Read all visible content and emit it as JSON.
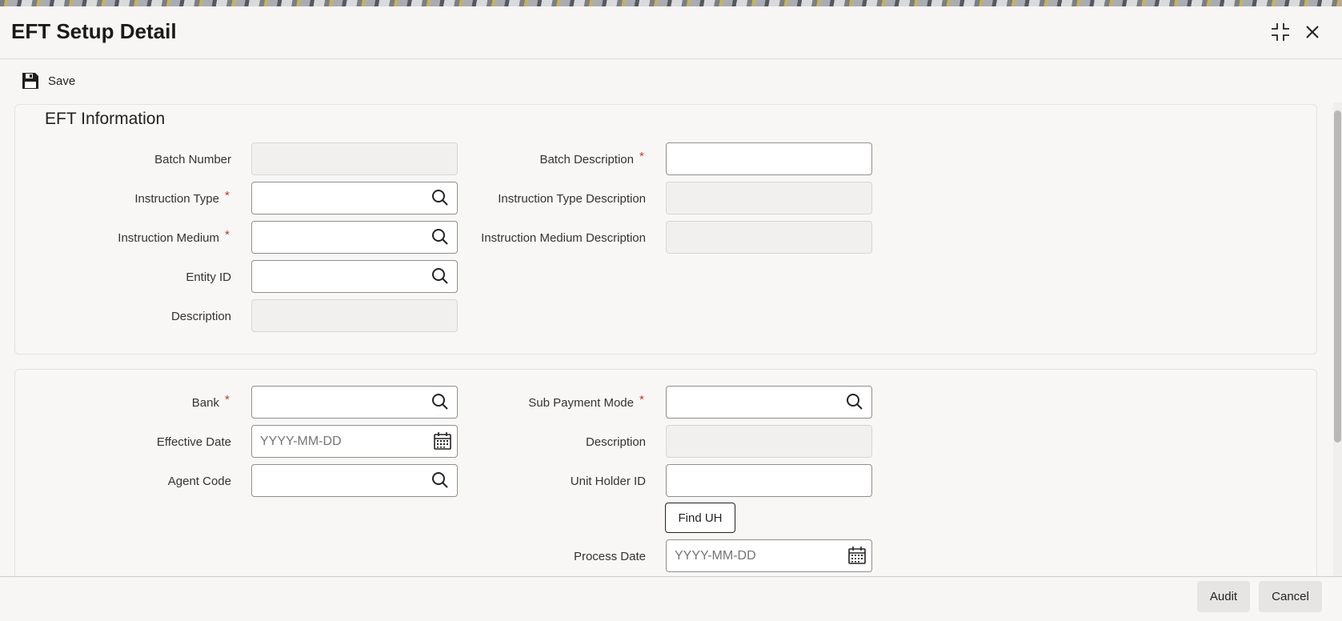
{
  "window": {
    "title": "EFT Setup Detail",
    "restore_icon": "collapse-icon",
    "close_icon": "close-icon"
  },
  "toolbar": {
    "save_label": "Save",
    "save_icon": "floppy-disk-icon"
  },
  "section1": {
    "title": "EFT Information",
    "batch_number_label": "Batch Number",
    "batch_description_label": "Batch Description",
    "instruction_type_label": "Instruction Type",
    "instruction_type_description_label": "Instruction Type Description",
    "instruction_medium_label": "Instruction Medium",
    "instruction_medium_description_label": "Instruction Medium Description",
    "entity_id_label": "Entity ID",
    "description_label": "Description"
  },
  "section2": {
    "bank_label": "Bank",
    "sub_payment_mode_label": "Sub Payment Mode",
    "effective_date_label": "Effective Date",
    "effective_date_placeholder": "YYYY-MM-DD",
    "description_label": "Description",
    "agent_code_label": "Agent Code",
    "unit_holder_id_label": "Unit Holder ID",
    "find_uh_label": "Find UH",
    "process_date_label": "Process Date",
    "process_date_placeholder": "YYYY-MM-DD"
  },
  "required_marker": "*",
  "footer": {
    "audit_label": "Audit",
    "cancel_label": "Cancel"
  },
  "colors": {
    "required": "#c0392b",
    "background": "#f7f6f4"
  }
}
